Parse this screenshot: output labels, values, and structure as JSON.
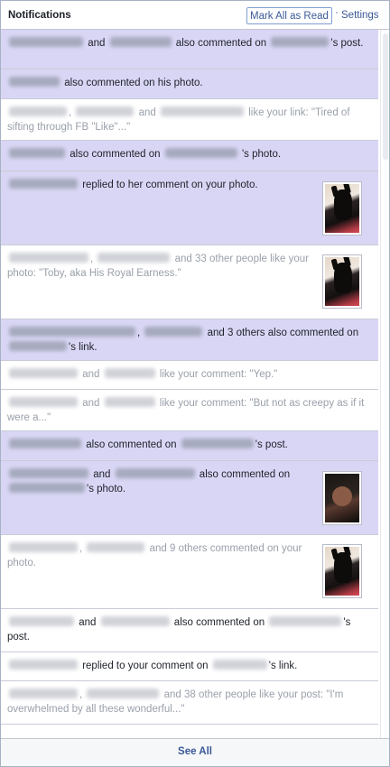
{
  "header": {
    "title": "Notifications",
    "mark_all_read": "Mark All as Read",
    "settings": "Settings"
  },
  "notifications": [
    {
      "status": "unread",
      "parts": [
        "and",
        "also commented on",
        "'s post."
      ]
    },
    {
      "status": "unread",
      "parts": [
        "also commented on his photo."
      ]
    },
    {
      "status": "read",
      "parts": [
        ",",
        "and",
        "like your link: \"Tired of sifting through FB \"Like\"...\""
      ]
    },
    {
      "status": "unread",
      "parts": [
        "also commented on",
        "'s photo."
      ]
    },
    {
      "status": "unread",
      "parts": [
        "replied to her comment on your photo."
      ],
      "thumbnail": "dog-photo"
    },
    {
      "status": "read",
      "parts": [
        ",",
        "and 33 other people like your photo: \"Toby, aka His Royal Earness.\""
      ],
      "thumbnail": "dog-photo"
    },
    {
      "status": "unread",
      "parts": [
        ",",
        "and 3 others also commented on",
        "'s link."
      ]
    },
    {
      "status": "read",
      "parts": [
        "and",
        "like your comment: \"Yep.\""
      ]
    },
    {
      "status": "read",
      "parts": [
        "and",
        "like your comment: \"But not as creepy as if it were a...\""
      ]
    },
    {
      "status": "unread",
      "parts": [
        "also commented on",
        "'s post."
      ]
    },
    {
      "status": "unread",
      "parts": [
        "and",
        "also commented on",
        "'s photo."
      ],
      "thumbnail": "dark-photo"
    },
    {
      "status": "read",
      "parts": [
        ",",
        "and 9 others commented on your photo."
      ],
      "thumbnail": "dog-photo"
    },
    {
      "status": "read",
      "parts": [
        "and",
        "also commented on",
        "'s post."
      ]
    },
    {
      "status": "read",
      "parts": [
        "replied to your comment on",
        "'s link."
      ]
    },
    {
      "status": "read",
      "parts": [
        ",",
        "and 38 other people like your post: \"I'm overwhelmed by all these wonderful...\""
      ]
    }
  ],
  "footer": {
    "see_all": "See All"
  },
  "colors": {
    "unread_bg": "#d9d6f5",
    "link": "#3b5998",
    "border": "#c8ccd6"
  }
}
